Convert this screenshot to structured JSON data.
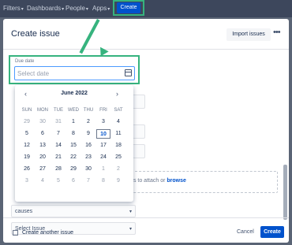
{
  "topbar": {
    "nav": [
      {
        "label": "Filters"
      },
      {
        "label": "Dashboards"
      },
      {
        "label": "People"
      },
      {
        "label": "Apps"
      }
    ],
    "create_label": "Create"
  },
  "modal": {
    "title": "Create issue",
    "import_label": "Import issues",
    "more_icon": "more-horizontal-icon",
    "due_date": {
      "label": "Due date",
      "placeholder": "Select date"
    },
    "calendar": {
      "month": "June 2022",
      "weekdays": [
        "SUN",
        "MON",
        "TUE",
        "WED",
        "THU",
        "FRI",
        "SAT"
      ],
      "weeks": [
        [
          "29",
          "30",
          "31",
          "1",
          "2",
          "3",
          "4"
        ],
        [
          "5",
          "6",
          "7",
          "8",
          "9",
          "10",
          "11"
        ],
        [
          "12",
          "13",
          "14",
          "15",
          "16",
          "17",
          "18"
        ],
        [
          "19",
          "20",
          "21",
          "22",
          "23",
          "24",
          "25"
        ],
        [
          "26",
          "27",
          "28",
          "29",
          "30",
          "1",
          "2"
        ],
        [
          "3",
          "4",
          "5",
          "6",
          "7",
          "8",
          "9"
        ]
      ],
      "today": "10"
    },
    "attach_text": "files to attach or",
    "attach_link": "browse",
    "link_type": "causes",
    "issue_placeholder": "Select Issue",
    "footer": {
      "create_another": "Create another issue",
      "cancel": "Cancel",
      "create": "Create"
    }
  },
  "colors": {
    "accent": "#0052cc",
    "highlight": "#36b37e"
  }
}
